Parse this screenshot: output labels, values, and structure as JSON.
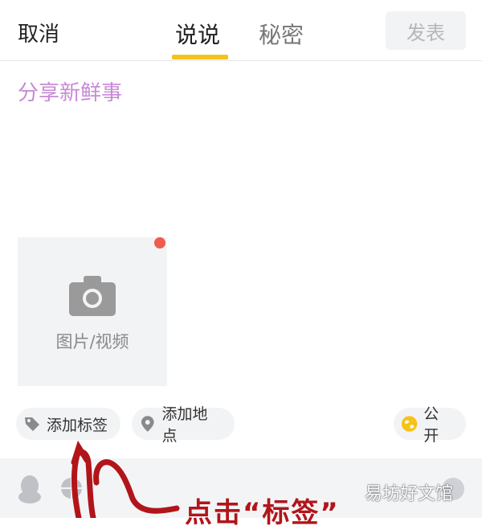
{
  "header": {
    "cancel_label": "取消",
    "tabs": [
      {
        "label": "说说",
        "active": true
      },
      {
        "label": "秘密",
        "active": false
      }
    ],
    "publish_label": "发表",
    "accent_color": "#f6c21a"
  },
  "compose": {
    "placeholder": "分享新鲜事",
    "placeholder_color": "#c78ad6"
  },
  "media": {
    "label": "图片/视频",
    "icon": "camera-icon",
    "badge_color": "#ef5b4c"
  },
  "chips": {
    "tag": {
      "label": "添加标签",
      "icon": "tag-icon"
    },
    "location": {
      "label": "添加地点",
      "icon": "location-pin-icon"
    },
    "visibility": {
      "label": "公开",
      "icon": "globe-icon"
    }
  },
  "bottom_bar": {
    "icons": [
      "qq-icon",
      "ball-icon",
      "round-icon"
    ]
  },
  "annotation": {
    "text": "点击“标签”",
    "color": "#b1151a"
  },
  "watermark": {
    "text": "易坊好文馆"
  }
}
